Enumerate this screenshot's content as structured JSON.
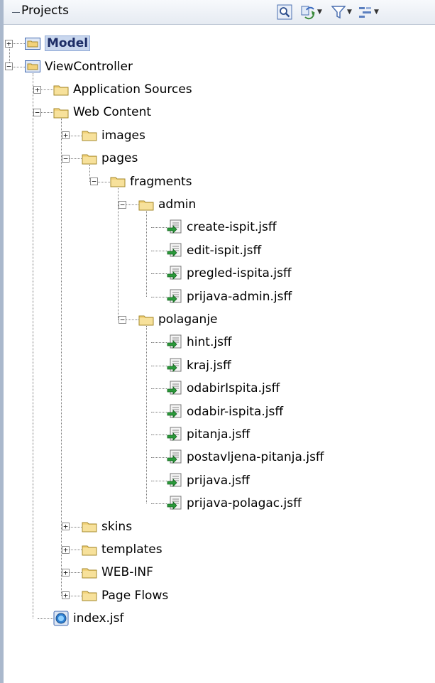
{
  "panel": {
    "title": "Projects"
  },
  "toolbar": [
    {
      "icon": "search-icon"
    },
    {
      "icon": "sync-icon",
      "dropdown": true
    },
    {
      "icon": "filter-icon",
      "dropdown": true
    },
    {
      "icon": "options-icon",
      "dropdown": true
    }
  ],
  "tree": [
    {
      "label": "Model",
      "type": "project",
      "expander": "+",
      "selected": true
    },
    {
      "label": "ViewController",
      "type": "project",
      "expander": "-"
    },
    {
      "label": "Application Sources",
      "type": "folder",
      "expander": "+"
    },
    {
      "label": "Web Content",
      "type": "folder",
      "expander": "-"
    },
    {
      "label": "images",
      "type": "folder",
      "expander": "+"
    },
    {
      "label": "pages",
      "type": "folder",
      "expander": "-"
    },
    {
      "label": "fragments",
      "type": "folder",
      "expander": "-"
    },
    {
      "label": "admin",
      "type": "folder",
      "expander": "-"
    },
    {
      "label": "create-ispit.jsff",
      "type": "jsff"
    },
    {
      "label": "edit-ispit.jsff",
      "type": "jsff"
    },
    {
      "label": "pregled-ispita.jsff",
      "type": "jsff"
    },
    {
      "label": "prijava-admin.jsff",
      "type": "jsff"
    },
    {
      "label": "polaganje",
      "type": "folder",
      "expander": "-"
    },
    {
      "label": "hint.jsff",
      "type": "jsff"
    },
    {
      "label": "kraj.jsff",
      "type": "jsff"
    },
    {
      "label": "odabirIspita.jsff",
      "type": "jsff"
    },
    {
      "label": "odabir-ispita.jsff",
      "type": "jsff"
    },
    {
      "label": "pitanja.jsff",
      "type": "jsff"
    },
    {
      "label": "postavljena-pitanja.jsff",
      "type": "jsff"
    },
    {
      "label": "prijava.jsff",
      "type": "jsff"
    },
    {
      "label": "prijava-polagac.jsff",
      "type": "jsff"
    },
    {
      "label": "skins",
      "type": "folder",
      "expander": "+"
    },
    {
      "label": "templates",
      "type": "folder",
      "expander": "+"
    },
    {
      "label": "WEB-INF",
      "type": "folder",
      "expander": "+"
    },
    {
      "label": "Page Flows",
      "type": "folder",
      "expander": "+"
    },
    {
      "label": "index.jsf",
      "type": "jsf"
    }
  ]
}
